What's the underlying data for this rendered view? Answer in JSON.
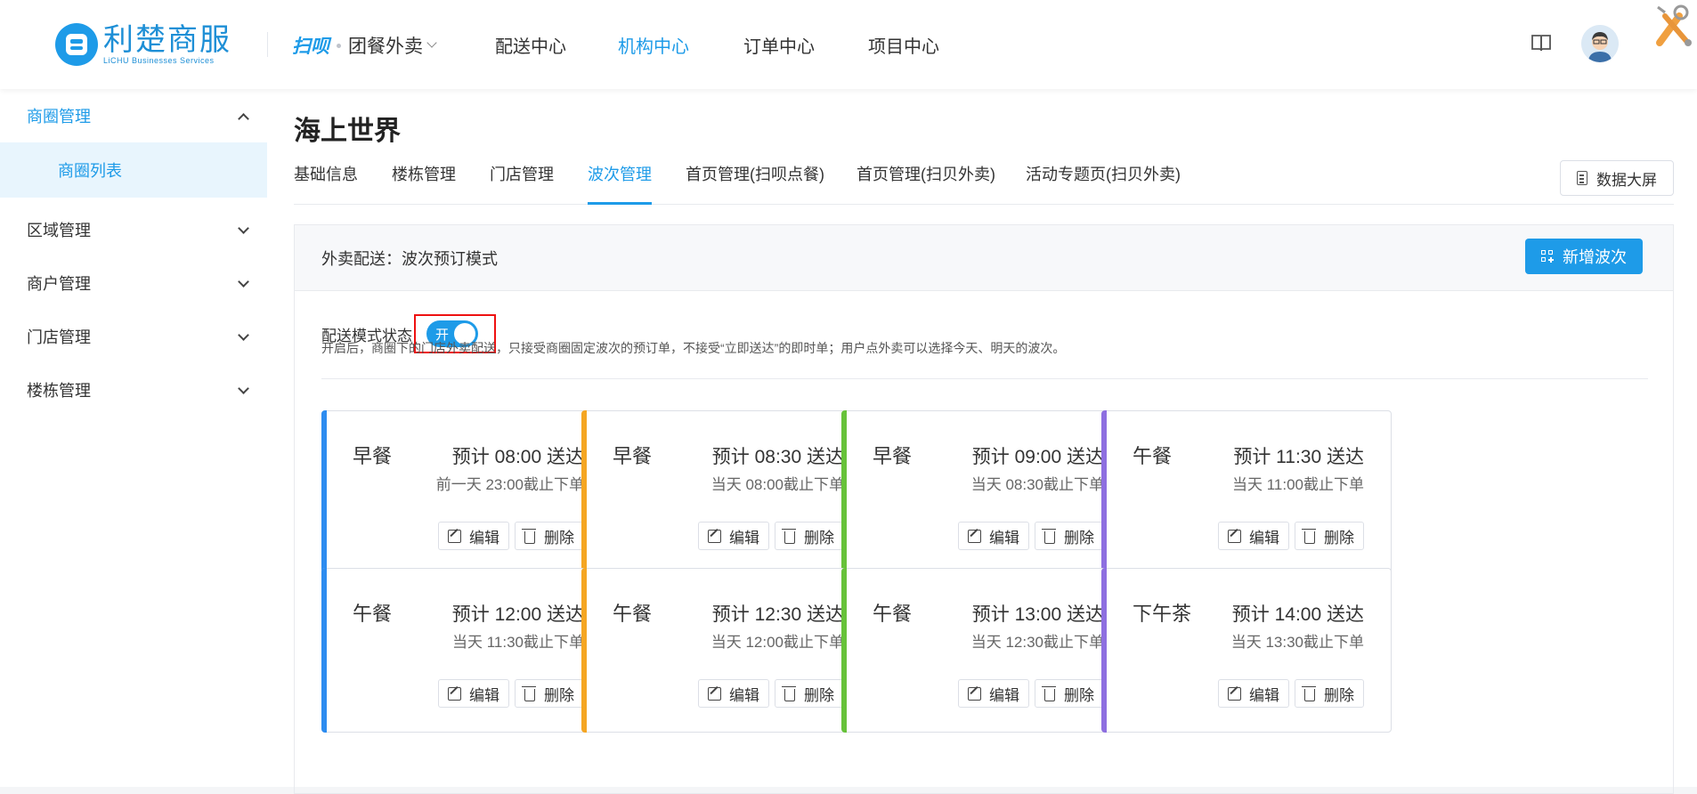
{
  "header": {
    "logo_cn": "利楚商服",
    "logo_en": "LiCHU Businesses Services",
    "brand_primary": "扫呗",
    "brand_secondary": "团餐外卖",
    "nav": [
      "配送中心",
      "机构中心",
      "订单中心",
      "项目中心"
    ],
    "active_nav": "机构中心"
  },
  "sidebar": {
    "groups": [
      {
        "label": "商圈管理",
        "open": true,
        "children": [
          "商圈列表"
        ]
      },
      {
        "label": "区域管理",
        "open": false
      },
      {
        "label": "商户管理",
        "open": false
      },
      {
        "label": "门店管理",
        "open": false
      },
      {
        "label": "楼栋管理",
        "open": false
      }
    ]
  },
  "page": {
    "title": "海上世界",
    "tabs": [
      "基础信息",
      "楼栋管理",
      "门店管理",
      "波次管理",
      "首页管理(扫呗点餐)",
      "首页管理(扫贝外卖)",
      "活动专题页(扫贝外卖)"
    ],
    "active_tab": "波次管理",
    "dashboard_button": "数据大屏"
  },
  "panel": {
    "header_label": "外卖配送：波次预订模式",
    "add_button": "新增波次",
    "mode_label": "配送模式状态",
    "switch_text": "开",
    "hint": "开启后，商圈下的门店外卖配送，只接受商圈固定波次的预订单，不接受“立即送达”的即时单；用户点外卖可以选择今天、明天的波次。"
  },
  "actions": {
    "edit": "编辑",
    "delete": "删除"
  },
  "colors": {
    "accent": "#1e9be8",
    "orange": "#f5a623",
    "green": "#67c23a",
    "purple": "#8e6fe0",
    "highlight_box": "#e11"
  },
  "waves": [
    {
      "meal": "早餐",
      "estimate": "预计 08:00 送达",
      "cutoff": "前一天 23:00截止下单",
      "color": "#2d8cf0"
    },
    {
      "meal": "早餐",
      "estimate": "预计 08:30 送达",
      "cutoff": "当天 08:00截止下单",
      "color": "#f5a623"
    },
    {
      "meal": "早餐",
      "estimate": "预计 09:00 送达",
      "cutoff": "当天 08:30截止下单",
      "color": "#67c23a"
    },
    {
      "meal": "午餐",
      "estimate": "预计 11:30 送达",
      "cutoff": "当天 11:00截止下单",
      "color": "#8e6fe0"
    },
    {
      "meal": "午餐",
      "estimate": "预计 12:00 送达",
      "cutoff": "当天 11:30截止下单",
      "color": "#2d8cf0"
    },
    {
      "meal": "午餐",
      "estimate": "预计 12:30 送达",
      "cutoff": "当天 12:00截止下单",
      "color": "#f5a623"
    },
    {
      "meal": "午餐",
      "estimate": "预计 13:00 送达",
      "cutoff": "当天 12:30截止下单",
      "color": "#67c23a"
    },
    {
      "meal": "下午茶",
      "estimate": "预计 14:00 送达",
      "cutoff": "当天 13:30截止下单",
      "color": "#8e6fe0"
    }
  ]
}
